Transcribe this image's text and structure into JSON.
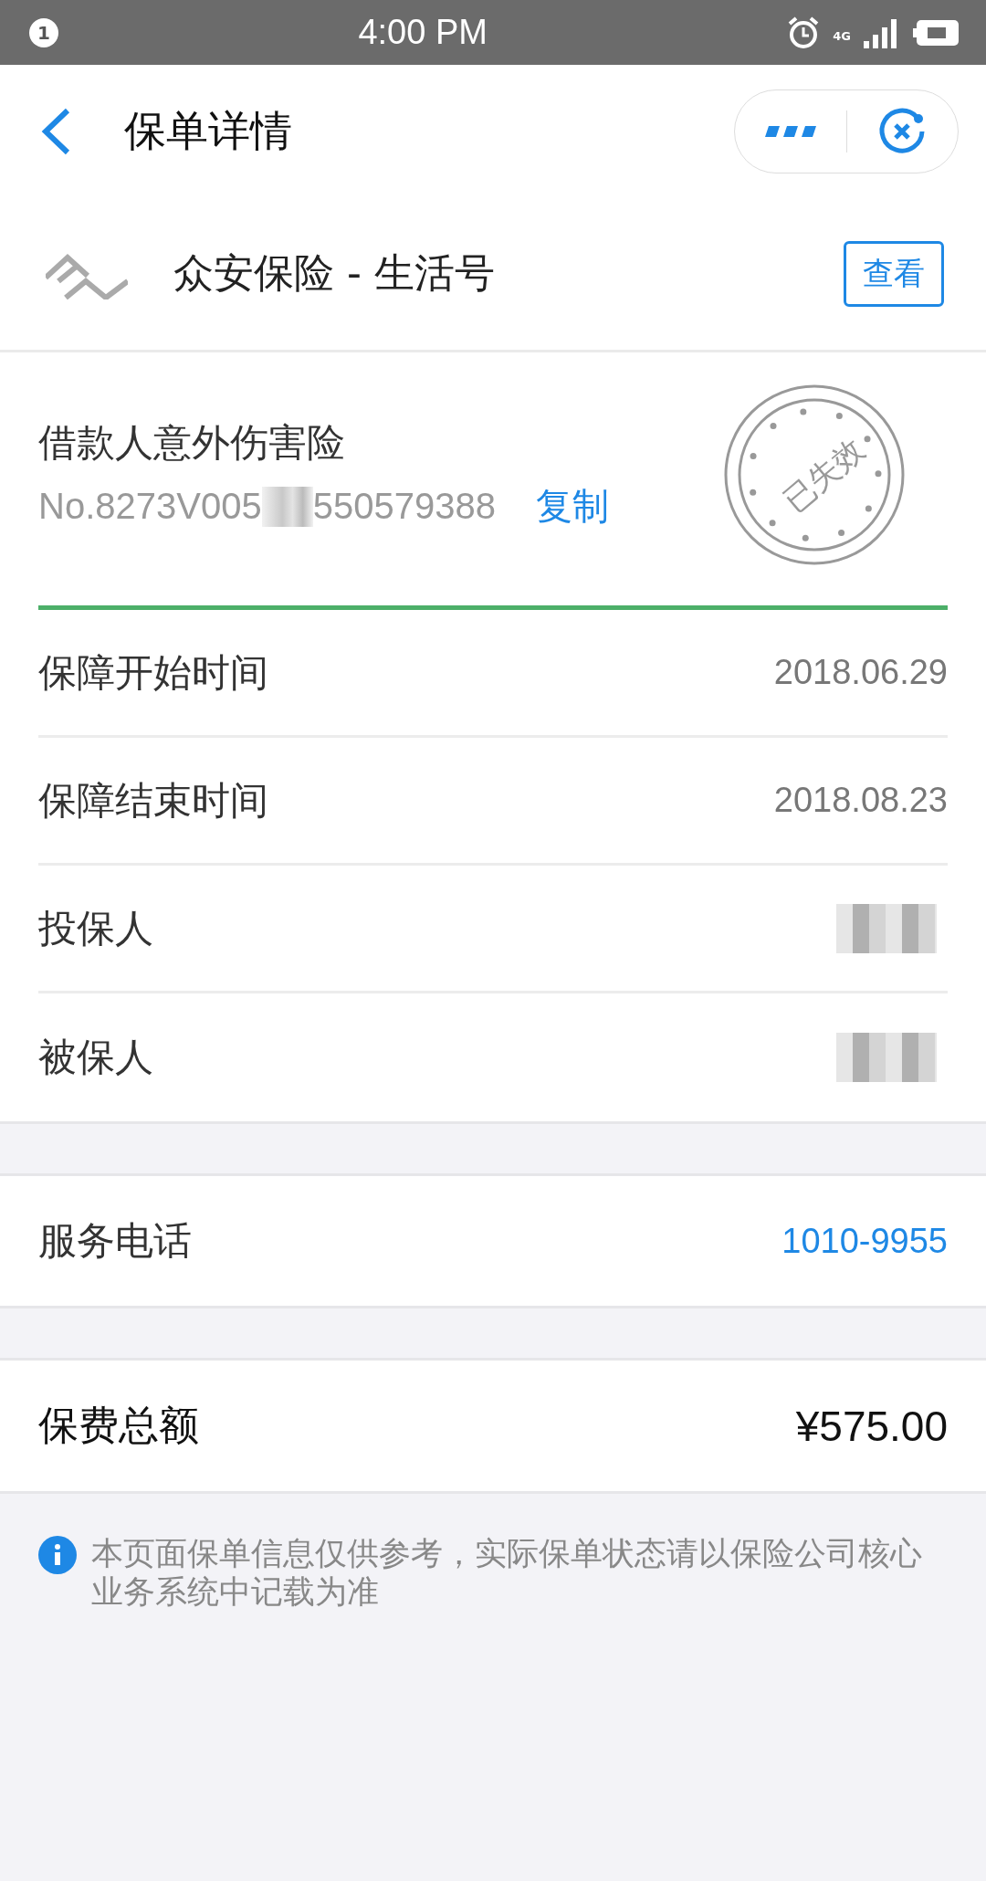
{
  "status_bar": {
    "notification_count": "1",
    "time": "4:00 PM",
    "network": "4G"
  },
  "header": {
    "title": "保单详情"
  },
  "brand": {
    "name": "众安保险 - 生活号",
    "action": "查看"
  },
  "policy": {
    "name": "借款人意外伤害险",
    "number_prefix": "No.8273V005",
    "number_suffix": "550579388",
    "copy": "复制",
    "stamp": "已失效",
    "redacted": true
  },
  "details": [
    {
      "kind": "text",
      "label": "保障开始时间",
      "value": "2018.06.29"
    },
    {
      "kind": "text",
      "label": "保障结束时间",
      "value": "2018.08.23"
    },
    {
      "kind": "redacted",
      "label": "投保人"
    },
    {
      "kind": "redacted",
      "label": "被保人"
    }
  ],
  "service": {
    "label": "服务电话",
    "value": "1010-9955"
  },
  "premium": {
    "label": "保费总额",
    "value": "¥575.00"
  },
  "note": "本页面保单信息仅供参考，实际保单状态请以保险公司核心业务系统中记载为准"
}
